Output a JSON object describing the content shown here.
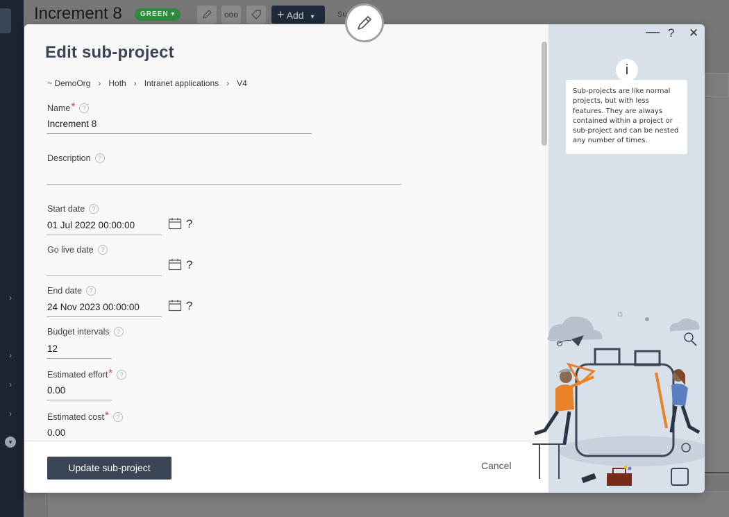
{
  "app": {
    "title": "Increment 8",
    "status_badge": "GREEN",
    "add_label": "Add",
    "sum_text": "Su"
  },
  "modal": {
    "title": "Edit sub-project",
    "breadcrumb": [
      "~ DemoOrg",
      "Hoth",
      "Intranet applications",
      "V4"
    ],
    "fields": {
      "name": {
        "label": "Name",
        "value": "Increment 8"
      },
      "description": {
        "label": "Description",
        "value": ""
      },
      "start_date": {
        "label": "Start date",
        "value": "01 Jul 2022 00:00:00"
      },
      "go_live_date": {
        "label": "Go live date",
        "value": ""
      },
      "end_date": {
        "label": "End date",
        "value": "24 Nov 2023 00:00:00"
      },
      "budget_intervals": {
        "label": "Budget intervals",
        "value": "12"
      },
      "estimated_effort": {
        "label": "Estimated effort",
        "value": "0.00"
      },
      "estimated_cost": {
        "label": "Estimated cost",
        "value": "0.00"
      }
    },
    "question_mark": "?",
    "update_button": "Update sub-project",
    "cancel_button": "Cancel",
    "window_controls": {
      "minimize": "—",
      "help": "?",
      "close": "✕"
    },
    "info": {
      "icon": "i",
      "text": "Sub-projects are like normal projects, but with less features. They are always contained within a project or sub-project and can be nested any number of times."
    }
  },
  "icons": {
    "edit": "pencil-icon",
    "calendar": "calendar-icon",
    "help": "help-circle-icon"
  }
}
